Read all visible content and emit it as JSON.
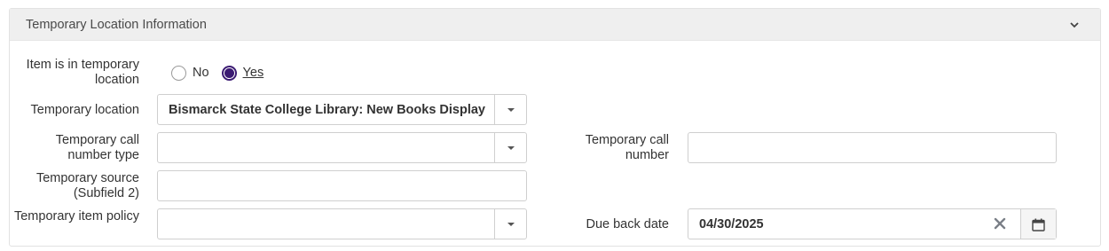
{
  "section": {
    "title": "Temporary Location Information"
  },
  "temp_flag": {
    "label": "Item is in temporary location",
    "options": [
      {
        "label": "No",
        "checked": false
      },
      {
        "label": "Yes",
        "checked": true
      }
    ]
  },
  "temp_location": {
    "label": "Temporary location",
    "value": "Bismarck State College Library: New Books Display"
  },
  "temp_call_number_type": {
    "label": "Temporary call number type",
    "value": ""
  },
  "temp_call_number": {
    "label": "Temporary call number",
    "value": ""
  },
  "temp_source": {
    "label": "Temporary source (Subfield 2)",
    "value": ""
  },
  "temp_item_policy": {
    "label": "Temporary item policy",
    "value": ""
  },
  "due_back_date": {
    "label": "Due back date",
    "value": "04/30/2025"
  },
  "icons": {
    "collapse": "chevron-down-icon",
    "dropdown": "caret-down-icon",
    "clear": "close-icon",
    "calendar": "calendar-icon"
  },
  "colors": {
    "header_bg": "#efefef",
    "radio_selected": "#3b1b73",
    "border": "#cfcfcf"
  }
}
